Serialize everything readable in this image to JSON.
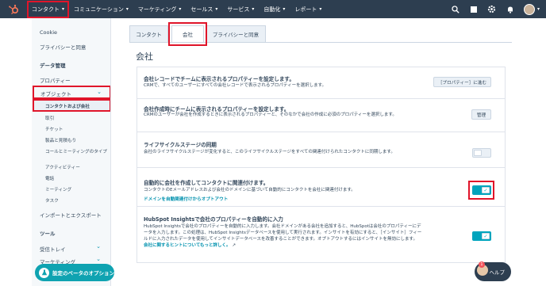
{
  "nav": {
    "items": [
      {
        "label": "コンタクト"
      },
      {
        "label": "コミュニケーション"
      },
      {
        "label": "マーケティング"
      },
      {
        "label": "セールス"
      },
      {
        "label": "サービス"
      },
      {
        "label": "自動化"
      },
      {
        "label": "レポート"
      }
    ],
    "icons": [
      "search-icon",
      "marketplace-icon",
      "settings-icon",
      "notifications-icon"
    ]
  },
  "sidebar": {
    "items": {
      "cookie": "Cookie",
      "privacy": "プライバシーと同意",
      "data_mgmt": "データ管理",
      "properties": "プロパティー",
      "objects": "オブジェクト",
      "contacts_companies": "コンタクトおよび会社",
      "deals": "取引",
      "tickets": "チケット",
      "products_quotes": "製品と見積もり",
      "calls_meetings": "コールとミーティングのタイプ",
      "activities": "アクティビティー",
      "calls": "電話",
      "meetings": "ミーティング",
      "tasks": "タスク",
      "import_export": "インポートとエクスポート",
      "tools": "ツール",
      "inbox": "受信トレイ",
      "marketing": "マーケティング"
    },
    "beta_button": "設定のベータのオプション"
  },
  "tabs": [
    {
      "label": "コンタクト"
    },
    {
      "label": "会社"
    },
    {
      "label": "プライバシーと同意"
    }
  ],
  "page": {
    "title": "会社"
  },
  "settings": [
    {
      "title": "会社レコードでチームに表示されるプロパティーを設定します。",
      "desc": "CRMで、すべてのユーザーにすべての会社レコードで表示されるプロパティーを選択します。",
      "button": "［プロパティー］に進む"
    },
    {
      "title": "会社作成時にチームに表示されるプロパティーを設定します。",
      "desc": "CRMのユーザーが会社を作成するときに表示されるプロパティーと、そのなかで会社の作成に必須のプロパティーを選択します。",
      "button": "管理"
    },
    {
      "title": "ライフサイクルステージの同期",
      "desc": "会社のライフサイクルステージが変化すると、このライフサイクルステージをすべての関連付けられたコンタクトに同期します。",
      "toggle": false
    },
    {
      "title": "自動的に会社を作成してコンタクトに関連付けます。",
      "desc": "コンタクトのEメールアドレスおよび会社のドメインに基づいて自動的にコンタクトを会社に関連付けます。",
      "link": "ドメインを自動関連付けからオプトアウト",
      "toggle": true
    },
    {
      "title": "HubSpot Insightsで会社のプロパティーを自動的に入力",
      "desc": "HubSpot Insightsで会社のプロパティーを自動的に入力します。会社ドメインがある会社を追加すると、HubSpotは会社のプロパティーにデータを入力します。この処理は、HubSpot Insightsデータベースを使用して実行されます。インサイトを有効にすると、［インサイト］フィールドに入力されたデータを使用してインサイトデータベースを改善することができます。オプトアウトするにはインサイトを無効にします。",
      "link": "会社に関するヒントについてもっと詳しく。",
      "toggle": true
    }
  ],
  "help": {
    "label": "ヘルプ",
    "badge": "1"
  },
  "colors": {
    "nav_bg": "#2d3e50",
    "accent": "#00a4bd",
    "link": "#0091ae",
    "highlight": "#e0152a"
  }
}
